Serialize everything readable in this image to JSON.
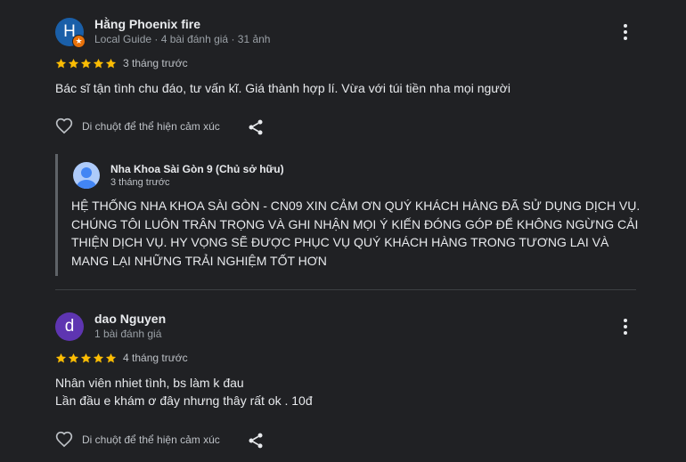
{
  "colors": {
    "background": "#202124",
    "star": "#fbbc04",
    "avatar_1": "#1a5fa8",
    "avatar_2": "#5e35b1",
    "local_guide_badge": "#e8710a"
  },
  "reviews": [
    {
      "avatar_letter": "H",
      "name": "Hằng Phoenix fire",
      "meta": "Local Guide · 4 bài đánh giá · 31 ảnh",
      "rating": 5,
      "time": "3 tháng trước",
      "text_lines": [
        "Bác sĩ tận tình chu đáo, tư vấn kĩ. Giá thành hợp lí. Vừa với túi tiền nha mọi người"
      ],
      "like_label": "Di chuột để thể hiện cảm xúc",
      "owner_reply": {
        "name": "Nha Khoa Sài Gòn 9 (Chủ sở hữu)",
        "time": "3 tháng trước",
        "text": "HỆ THỐNG NHA KHOA SÀI GÒN - CN09 XIN CẢM ƠN QUÝ KHÁCH HÀNG ĐÃ SỬ DỤNG DỊCH VỤ. CHÚNG TÔI LUÔN TRÂN TRỌNG VÀ GHI NHẬN MỌI Ý KIẾN ĐÓNG GÓP ĐỂ KHÔNG NGỪNG CẢI THIỆN DỊCH VỤ. HY VỌNG SẼ ĐƯỢC PHỤC VỤ QUÝ KHÁCH HÀNG TRONG TƯƠNG LAI VÀ MANG LẠI NHỮNG TRẢI NGHIỆM TỐT HƠN"
      }
    },
    {
      "avatar_letter": "d",
      "name": "dao Nguyen",
      "meta": "1 bài đánh giá",
      "rating": 5,
      "time": "4 tháng trước",
      "text_lines": [
        "Nhân viên nhiet tình, bs làm k đau",
        "Lần đầu e khám ơ đây nhưng thây rất ok . 10đ"
      ],
      "like_label": "Di chuột để thể hiện cảm xúc"
    }
  ]
}
